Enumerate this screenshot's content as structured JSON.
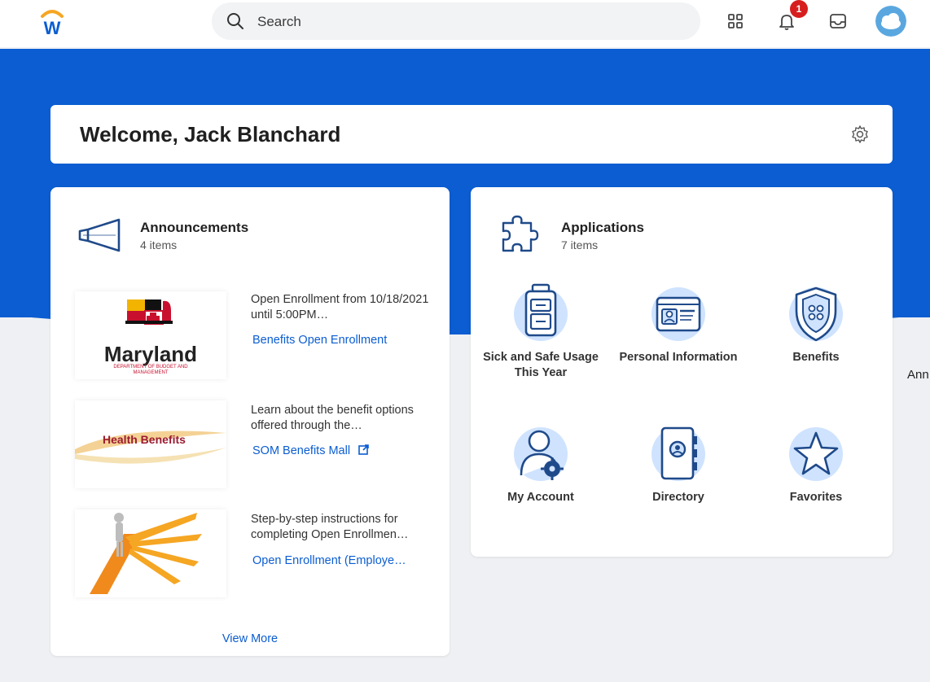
{
  "topbar": {
    "logo_letter": "W",
    "search": {
      "placeholder": "Search",
      "value": ""
    },
    "notifications_count": "1",
    "icons": [
      "apps-grid-icon",
      "bell-icon",
      "inbox-icon",
      "avatar"
    ]
  },
  "colors": {
    "brand_blue": "#0b5dd1",
    "badge_red": "#d71e1e",
    "logo_orange": "#f5a623",
    "icon_light_blue": "#cfe3ff"
  },
  "welcome": {
    "title": "Welcome, Jack Blanchard"
  },
  "announcements": {
    "title": "Announcements",
    "count": "4 items",
    "items": [
      {
        "image_text": "Maryland",
        "image_subtext": "DEPARTMENT OF BUDGET AND MANAGEMENT",
        "description": "Open Enrollment from 10/18/2021 until 5:00PM…",
        "link": "Benefits Open Enrollment"
      },
      {
        "image_text": "Health Benefits",
        "description": "Learn about the benefit options offered through the…",
        "link": "SOM Benefits Mall"
      },
      {
        "image_text": "",
        "description": "Step-by-step instructions for completing Open Enrollmen…",
        "link": "Open Enrollment (Employe…"
      }
    ],
    "view_more": "View More"
  },
  "applications": {
    "title": "Applications",
    "count": "7 items",
    "tiles": [
      {
        "label": "Sick and Safe Usage This Year",
        "icon": "suitcase-icon"
      },
      {
        "label": "Personal Information",
        "icon": "id-card-icon"
      },
      {
        "label": "Benefits",
        "icon": "shield-icon"
      },
      {
        "label": "My Account",
        "icon": "user-gear-icon"
      },
      {
        "label": "Directory",
        "icon": "address-book-icon"
      },
      {
        "label": "Favorites",
        "icon": "star-icon"
      }
    ]
  },
  "side_label": "Ann"
}
